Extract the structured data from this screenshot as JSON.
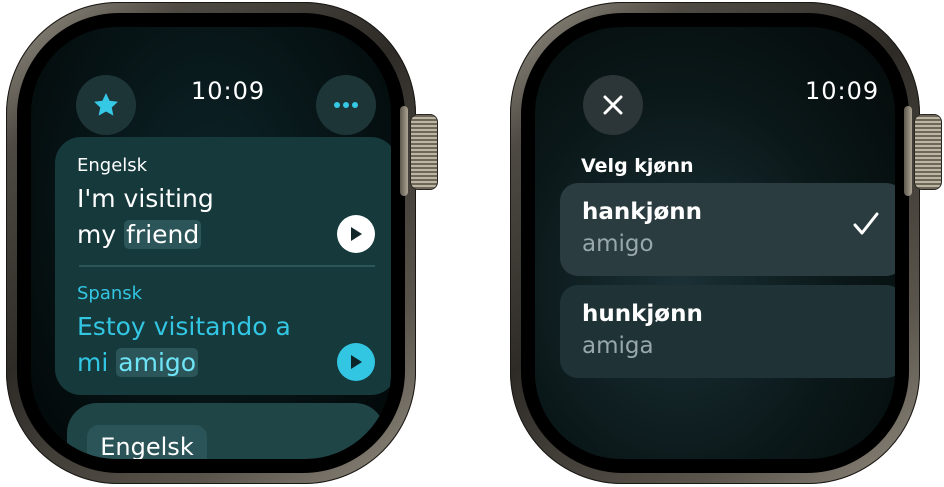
{
  "left_watch": {
    "time": "10:09",
    "favorite_icon": "star-icon",
    "more_icon": "ellipsis-icon",
    "source": {
      "language": "Engelsk",
      "line1": "I'm visiting",
      "line2_prefix": "my",
      "highlight": "friend"
    },
    "target": {
      "language": "Spansk",
      "line1": "Estoy visitando a",
      "line2_prefix": "mi",
      "highlight": "amigo"
    },
    "language_button": "Engelsk",
    "colors": {
      "accent": "#32c6e3",
      "card": "#16393c"
    }
  },
  "right_watch": {
    "time": "10:09",
    "close_icon": "close-icon",
    "section_title": "Velg kjønn",
    "options": [
      {
        "title": "hankjønn",
        "subtitle": "amigo",
        "selected": true
      },
      {
        "title": "hunkjønn",
        "subtitle": "amiga",
        "selected": false
      }
    ]
  }
}
